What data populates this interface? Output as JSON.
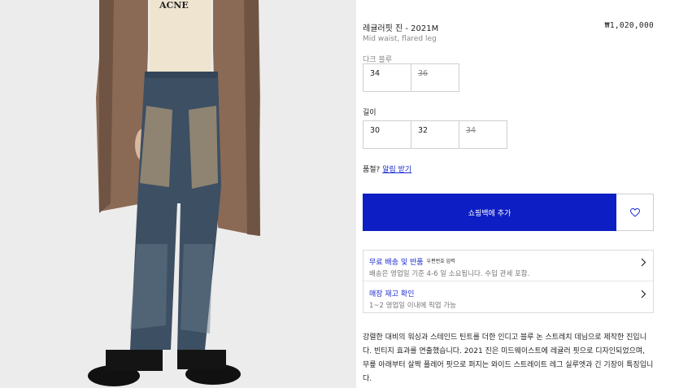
{
  "product": {
    "title": "레귤러핏 진 - 2021M",
    "price": "₩1,020,000",
    "subtitle": "Mid waist, flared leg",
    "color_label": "다크 블루",
    "waist_sizes": [
      {
        "label": "34",
        "available": true
      },
      {
        "label": "36",
        "available": false
      }
    ],
    "length_label": "길이",
    "length_sizes": [
      {
        "label": "30",
        "available": true
      },
      {
        "label": "32",
        "available": true
      },
      {
        "label": "34",
        "available": false
      }
    ],
    "notify_prefix": "품절?",
    "notify_link": "알림 받기",
    "add_to_cart": "쇼핑백에 추가",
    "wishlist_icon": "heart-icon"
  },
  "info": {
    "shipping_title": "무료 배송 및 반품",
    "shipping_badge": "우편번호 입력",
    "shipping_text": "배송은 영업일 기준 4-6 일 소요됩니다. 수입 관세 포함.",
    "stock_title": "매장 재고 확인",
    "stock_text": "1~2 영업일 이내에 픽업 가능"
  },
  "description": "강렬한 대비의 워싱과 스테인드 틴트를 더한 인디고 블루 논 스트레치 데님으로 제작한 진입니다. 빈티지 효과를 연출했습니다. 2021 진은 미드웨이스트에 레귤러 핏으로 디자인되었으며, 무릎 아래부터 살짝 플레어 핏으로 퍼지는 와이드 스트레이트 레그 실루엣과 긴 기장이 특징입니다.",
  "colors": {
    "accent": "#0d1fc4",
    "link": "#1b2bd2",
    "background": "#ececec"
  }
}
